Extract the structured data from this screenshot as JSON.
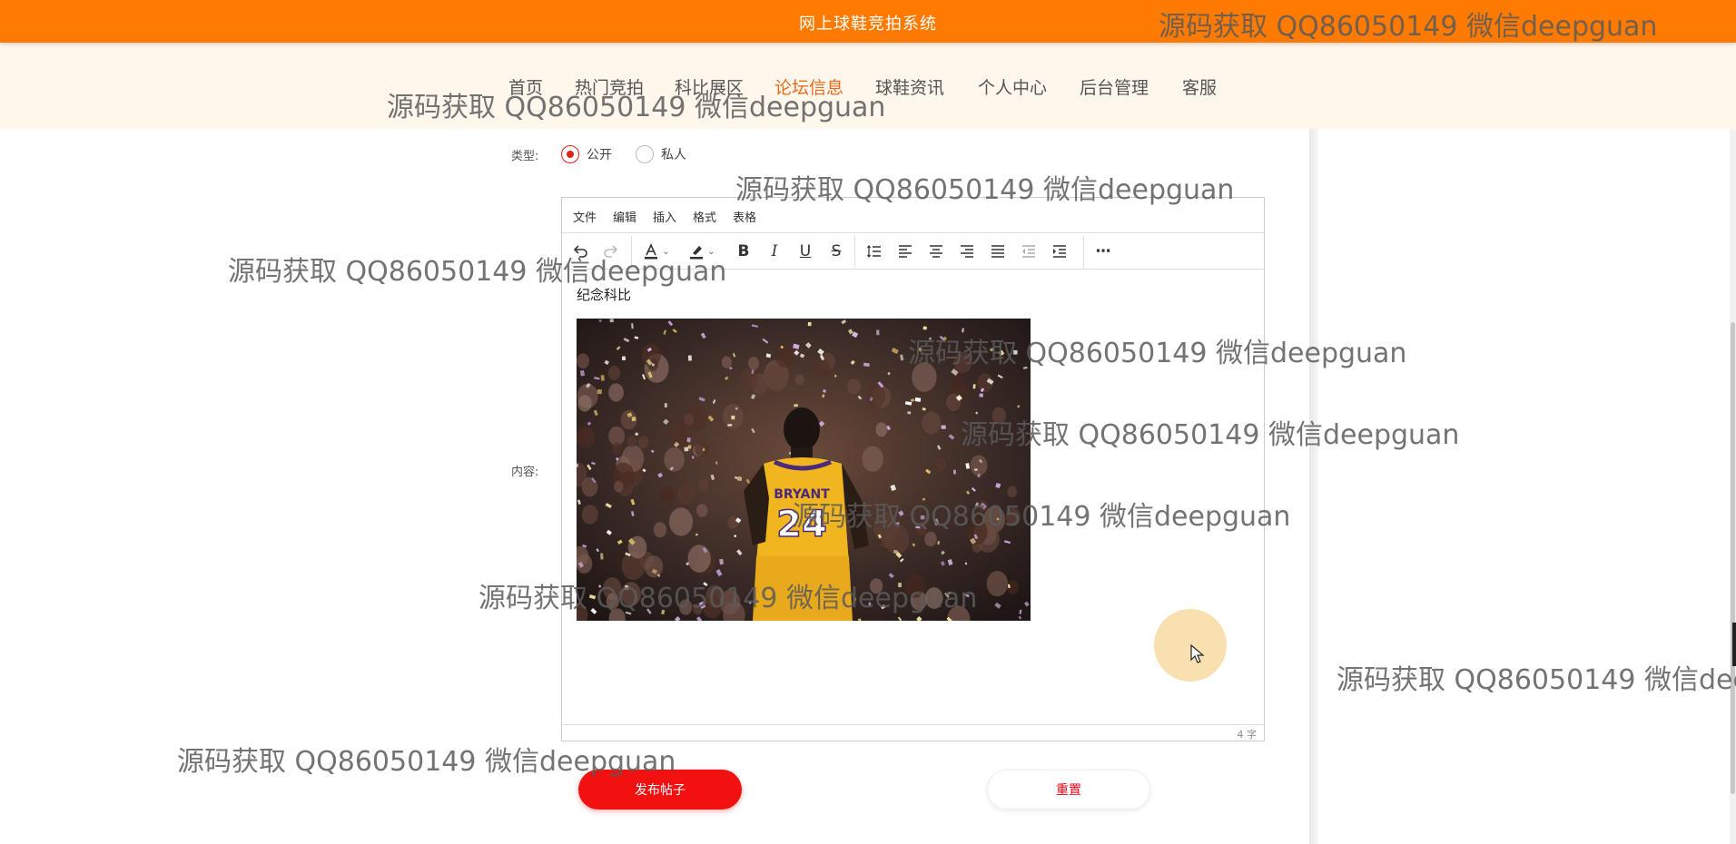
{
  "header": {
    "title": "网上球鞋竞拍系统"
  },
  "nav": {
    "items": [
      {
        "label": "首页"
      },
      {
        "label": "热门竞拍"
      },
      {
        "label": "科比展区"
      },
      {
        "label": "论坛信息",
        "active": true
      },
      {
        "label": "球鞋资讯"
      },
      {
        "label": "个人中心"
      },
      {
        "label": "后台管理"
      },
      {
        "label": "客服"
      }
    ]
  },
  "form": {
    "type_label": "类型:",
    "type_options": [
      {
        "label": "公开",
        "checked": true
      },
      {
        "label": "私人",
        "checked": false
      }
    ],
    "content_label": "内容:"
  },
  "editor": {
    "menus": [
      "文件",
      "编辑",
      "插入",
      "格式",
      "表格"
    ],
    "toolbar": [
      "undo-icon",
      "redo-icon",
      "text-color-icon",
      "highlight-icon",
      "bold-icon",
      "italic-icon",
      "underline-icon",
      "strikethrough-icon",
      "line-height-icon",
      "align-left-icon",
      "align-center-icon",
      "align-right-icon",
      "justify-icon",
      "outdent-icon",
      "indent-icon",
      "more-icon"
    ],
    "content_text": "纪念科比",
    "image": {
      "jersey_name": "BRYANT",
      "jersey_number": "24"
    },
    "word_count": "4 字"
  },
  "buttons": {
    "submit": "发布帖子",
    "reset": "重置"
  },
  "watermark": {
    "text": "源码获取 QQ86050149 微信deepguan"
  },
  "colors": {
    "header_bg": "#ff7a00",
    "nav_bg": "#fff6ec",
    "nav_active": "#e96c1e",
    "primary_button": "#f21111",
    "radio_checked": "#d9251c"
  }
}
